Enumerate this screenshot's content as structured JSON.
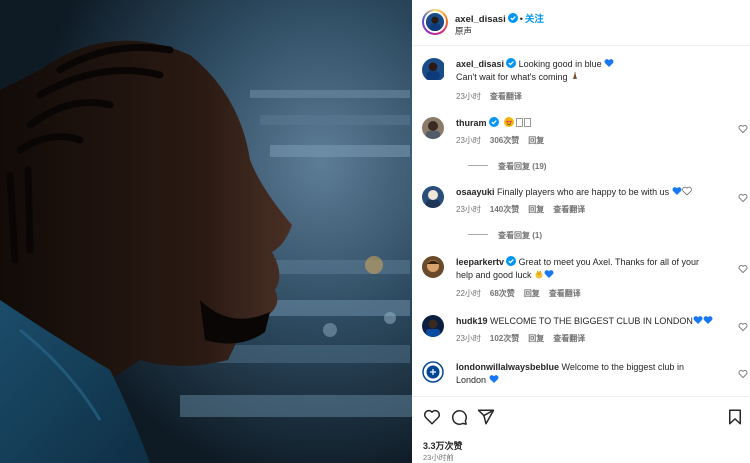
{
  "post": {
    "author": "axel_disasi",
    "follow_label": "关注",
    "dot": "•",
    "audio_label": "原声",
    "caption_line1": "Looking good in blue",
    "caption_line2": "Can't wait for what's coming",
    "caption_time": "23小时",
    "caption_translate": "查看翻译"
  },
  "comments": [
    {
      "username": "thuram",
      "text": "",
      "time": "23小时",
      "likes": "306次赞",
      "reply": "回复",
      "replies": "查看回复 (19)"
    },
    {
      "username": "osaayuki",
      "text": "Finally players who are happy to be with us",
      "time": "23小时",
      "likes": "140次赞",
      "reply": "回复",
      "translate": "查看翻译",
      "replies": "查看回复 (1)"
    },
    {
      "username": "leeparkertv",
      "text_line1": "Great to meet you Axel. Thanks for all of your",
      "text_line2": "help and good luck",
      "time": "22小时",
      "likes": "68次赞",
      "reply": "回复",
      "translate": "查看翻译"
    },
    {
      "username": "hudk19",
      "text": "WELCOME TO THE BIGGEST CLUB IN LONDON",
      "time": "23小时",
      "likes": "102次赞",
      "reply": "回复",
      "translate": "查看翻译"
    },
    {
      "username": "londonwillalwaysbeblue",
      "text_line1": "Welcome to the biggest club in",
      "text_line2": "London"
    }
  ],
  "footer": {
    "like_count": "3.3万次赞",
    "post_time": "23小时前"
  },
  "icons": {
    "like": "heart-icon",
    "comment": "comment-icon",
    "share": "share-icon",
    "save": "bookmark-icon",
    "verified": "verified-badge-icon"
  },
  "colors": {
    "blue_heart": "#1877f2",
    "follow": "#0095f6",
    "verified": "#0095f6",
    "muted_text": "#737373"
  }
}
